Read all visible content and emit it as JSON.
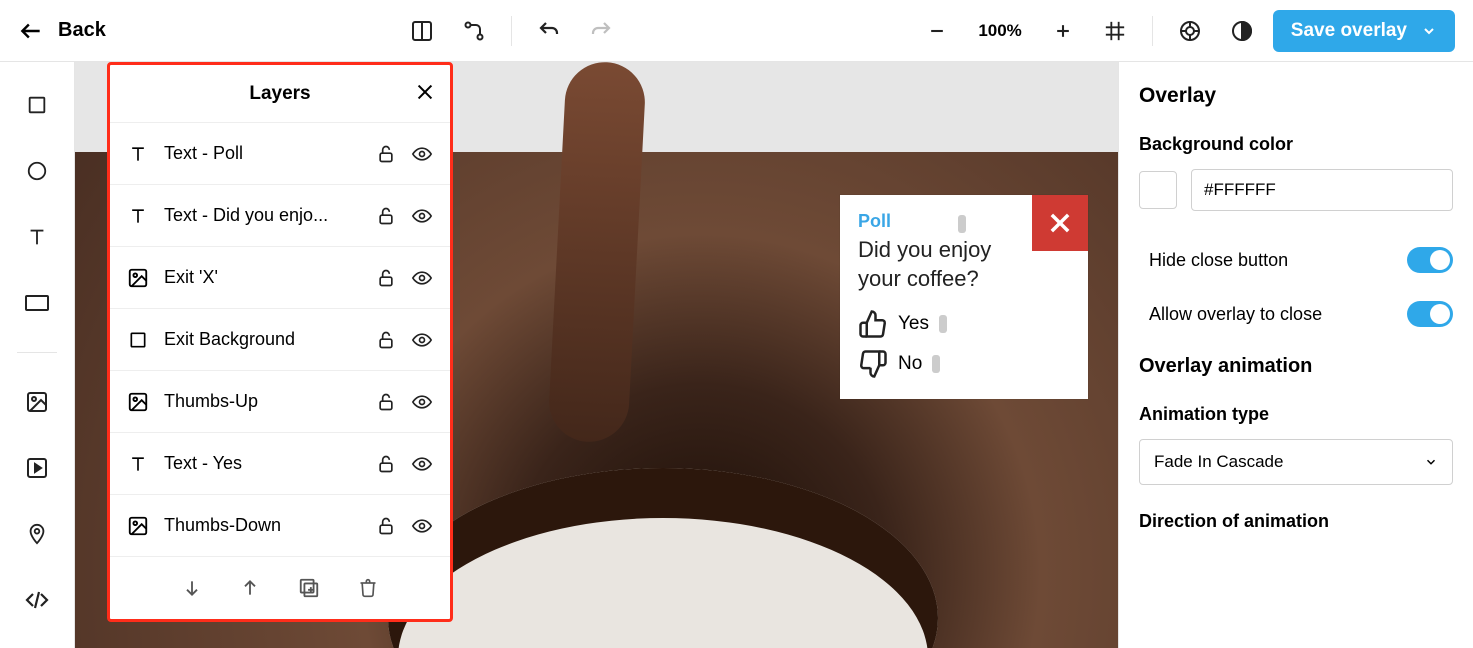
{
  "topbar": {
    "back_label": "Back",
    "zoom": "100%",
    "save_label": "Save overlay"
  },
  "layers_panel": {
    "title": "Layers",
    "items": [
      {
        "icon": "text",
        "label": "Text - Poll"
      },
      {
        "icon": "text",
        "label": "Text - Did you enjo..."
      },
      {
        "icon": "image",
        "label": "Exit 'X'"
      },
      {
        "icon": "rect",
        "label": "Exit Background"
      },
      {
        "icon": "image",
        "label": "Thumbs-Up"
      },
      {
        "icon": "text",
        "label": "Text - Yes"
      },
      {
        "icon": "image",
        "label": "Thumbs-Down"
      }
    ]
  },
  "poll": {
    "title": "Poll",
    "question": "Did you enjoy your coffee?",
    "opt_yes": "Yes",
    "opt_no": "No"
  },
  "sidebar": {
    "heading": "Overlay",
    "bg_color_label": "Background color",
    "bg_color_value": "#FFFFFF",
    "hide_close_label": "Hide close button",
    "allow_close_label": "Allow overlay to close",
    "animation_heading": "Overlay animation",
    "animation_type_label": "Animation type",
    "animation_type_value": "Fade In Cascade",
    "direction_label": "Direction of animation"
  }
}
